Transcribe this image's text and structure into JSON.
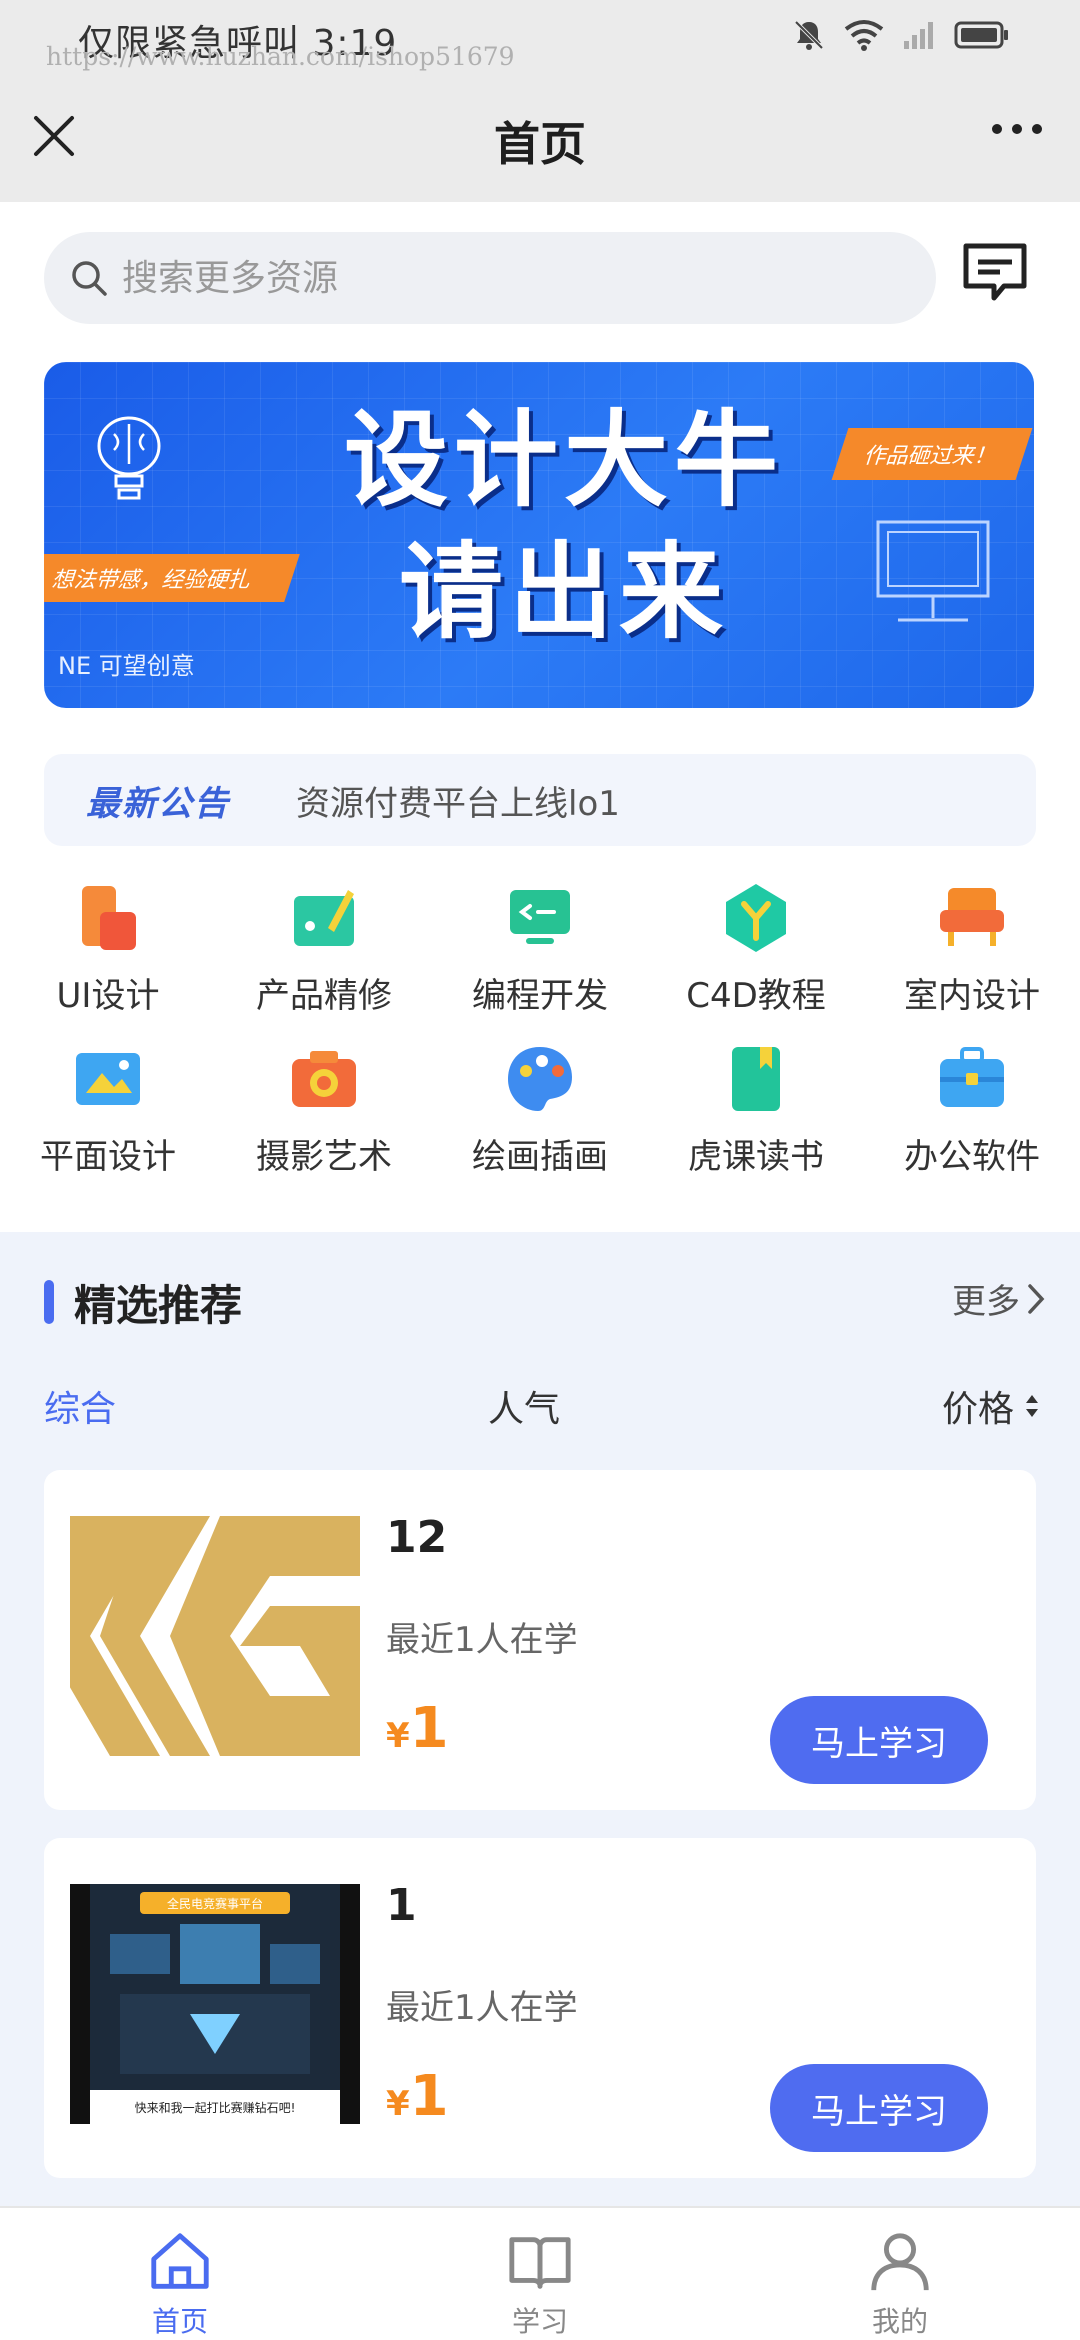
{
  "status_bar": {
    "text": "仅限紧急呼叫 3:19",
    "watermark": "https://www.huzhan.com/ishop51679"
  },
  "header": {
    "title": "首页"
  },
  "search": {
    "placeholder": "搜索更多资源"
  },
  "banner": {
    "title_line1": "设计大牛",
    "title_line2": "请出来",
    "tag": "作品砸过来！",
    "stripe": "想法带感，经验硬扎",
    "small": "NE 可望创意"
  },
  "notice": {
    "label": "最新公告",
    "text": "资源付费平台上线lo1"
  },
  "categories": [
    {
      "label": "UI设计",
      "icon": "ui-design-icon",
      "color": "#f26b3a"
    },
    {
      "label": "产品精修",
      "icon": "product-retouch-icon",
      "color": "#2bc7a2"
    },
    {
      "label": "编程开发",
      "icon": "programming-icon",
      "color": "#27c293"
    },
    {
      "label": "C4D教程",
      "icon": "c4d-icon",
      "color": "#1fc9a4"
    },
    {
      "label": "室内设计",
      "icon": "interior-design-icon",
      "color": "#f58a2a"
    },
    {
      "label": "平面设计",
      "icon": "graphic-design-icon",
      "color": "#3ea6f2"
    },
    {
      "label": "摄影艺术",
      "icon": "photography-icon",
      "color": "#f26b3a"
    },
    {
      "label": "绘画插画",
      "icon": "painting-icon",
      "color": "#3e8cf0"
    },
    {
      "label": "虎课读书",
      "icon": "reading-icon",
      "color": "#22c49a"
    },
    {
      "label": "办公软件",
      "icon": "office-software-icon",
      "color": "#3ea6f2"
    }
  ],
  "featured": {
    "title": "精选推荐",
    "more": "更多"
  },
  "sort": {
    "all": "综合",
    "popular": "人气",
    "price": "价格"
  },
  "courses": [
    {
      "title": "12",
      "subtitle": "最近1人在学",
      "currency": "¥",
      "price": "1",
      "button": "马上学习"
    },
    {
      "title": "1",
      "subtitle": "最近1人在学",
      "currency": "¥",
      "price": "1",
      "button": "马上学习",
      "thumb_top": "全民电竞赛事平台",
      "thumb_bottom": "快来和我一起打比赛赚钻石吧!"
    }
  ],
  "tabbar": [
    {
      "label": "首页",
      "icon": "home-icon",
      "active": true
    },
    {
      "label": "学习",
      "icon": "book-icon",
      "active": false
    },
    {
      "label": "我的",
      "icon": "profile-icon",
      "active": false
    }
  ],
  "colors": {
    "accent": "#4a6cf0",
    "price": "#f58a1f"
  }
}
